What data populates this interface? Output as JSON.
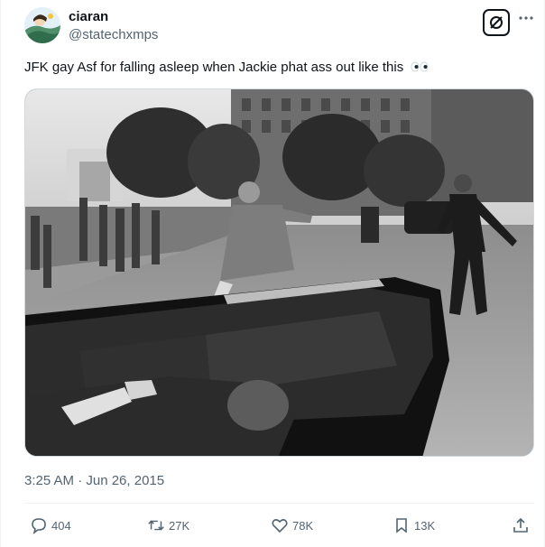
{
  "author": {
    "name": "ciaran",
    "handle": "@statechxmps"
  },
  "tweet": {
    "text": "JFK gay Asf for falling asleep when Jackie phat ass out like this",
    "emoji": "eyes-emoji"
  },
  "meta": {
    "timestamp": "3:25 AM · Jun 26, 2015"
  },
  "actions": {
    "replies": "404",
    "retweets": "27K",
    "likes": "78K",
    "bookmarks": "13K"
  },
  "icons": [
    "grok-icon",
    "more-icon",
    "reply-icon",
    "retweet-icon",
    "like-icon",
    "bookmark-icon",
    "share-icon"
  ],
  "colors": {
    "text": "#0f1419",
    "muted": "#536471",
    "divider": "#eff3f4"
  }
}
